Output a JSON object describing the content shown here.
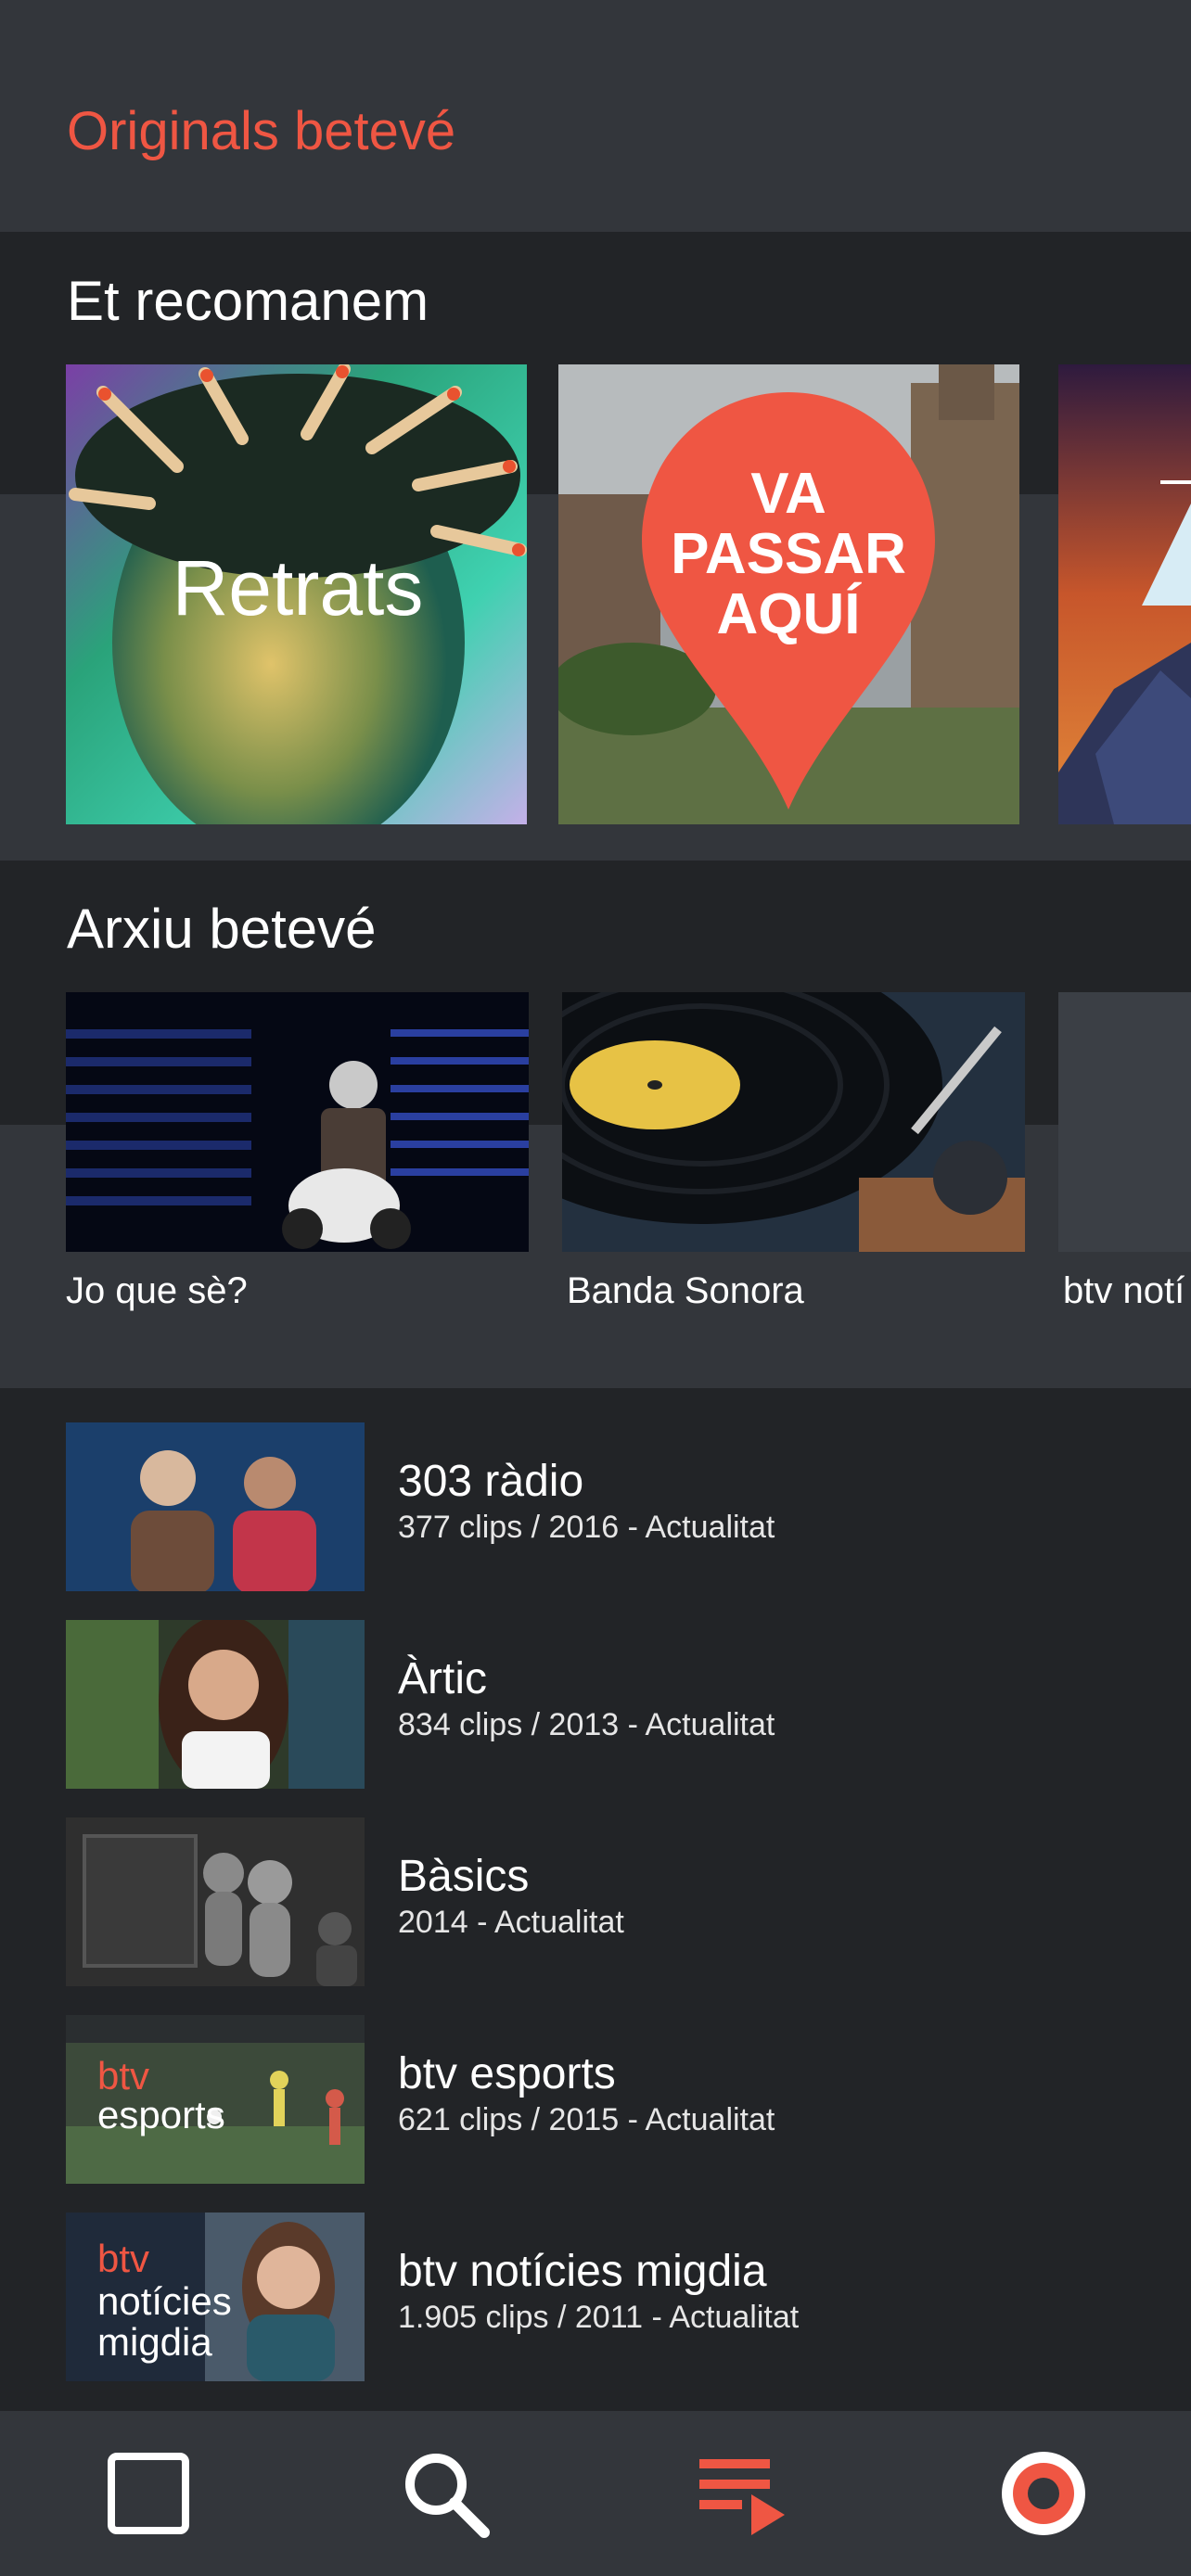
{
  "header": {
    "title": "Originals betevé"
  },
  "recommended": {
    "title": "Et recomanem",
    "cards": [
      {
        "overlay": "Retrats"
      },
      {
        "overlay_lines": [
          "VA",
          "PASSAR",
          "AQUÍ"
        ]
      },
      {
        "overlay": ""
      }
    ]
  },
  "archive": {
    "title": "Arxiu betevé",
    "cards": [
      {
        "caption": "Jo que sè?"
      },
      {
        "caption": "Banda Sonora"
      },
      {
        "caption": "btv notí"
      }
    ]
  },
  "programs": [
    {
      "title": "303 ràdio",
      "subtitle": "377 clips / 2016 - Actualitat",
      "thumb_text": ""
    },
    {
      "title": "Àrtic",
      "subtitle": "834 clips / 2013 - Actualitat",
      "thumb_text": ""
    },
    {
      "title": "Bàsics",
      "subtitle": "2014 - Actualitat",
      "thumb_text": ""
    },
    {
      "title": "btv esports",
      "subtitle": "621 clips / 2015 - Actualitat",
      "thumb_brand": "btv",
      "thumb_lines": [
        "esports"
      ]
    },
    {
      "title": "btv notícies migdia",
      "subtitle": "1.905 clips / 2011 - Actualitat",
      "thumb_brand": "btv",
      "thumb_lines": [
        "notícies",
        "migdia"
      ]
    }
  ],
  "nav": {
    "items": [
      {
        "icon": "square-icon",
        "active": false
      },
      {
        "icon": "search-icon",
        "active": false
      },
      {
        "icon": "playlist-icon",
        "active": true
      },
      {
        "icon": "live-record-icon",
        "active": false
      }
    ]
  },
  "colors": {
    "accent": "#ef5643",
    "background": "#33363b",
    "band": "#222427",
    "text": "#ffffff"
  }
}
